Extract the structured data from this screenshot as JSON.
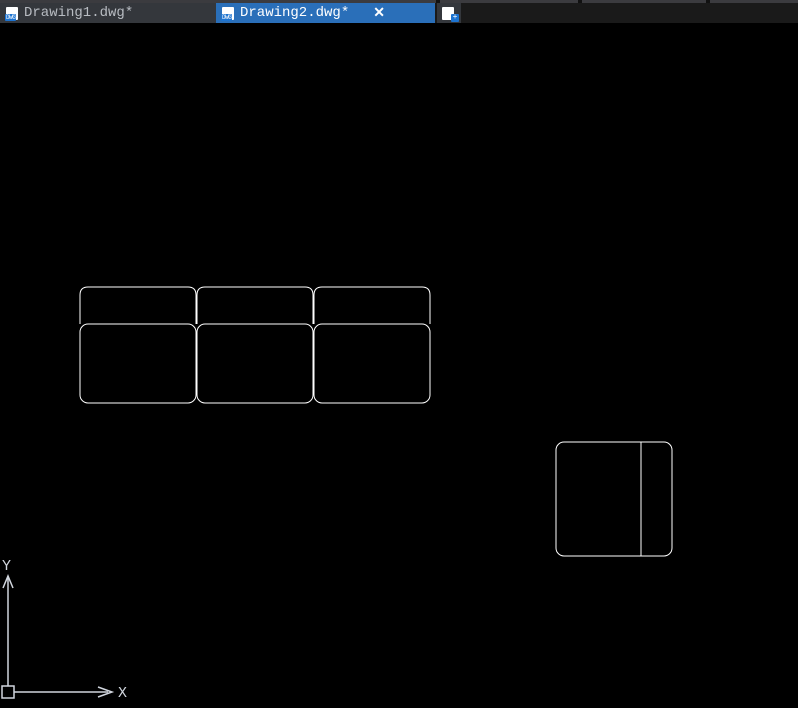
{
  "tabs": {
    "inactive": {
      "label": "Drawing1.dwg*"
    },
    "active": {
      "label": "Drawing2.dwg*",
      "close": "✕"
    }
  },
  "newTab": {
    "plus": "+"
  },
  "ucs": {
    "yLabel": "Y",
    "xLabel": "X"
  }
}
